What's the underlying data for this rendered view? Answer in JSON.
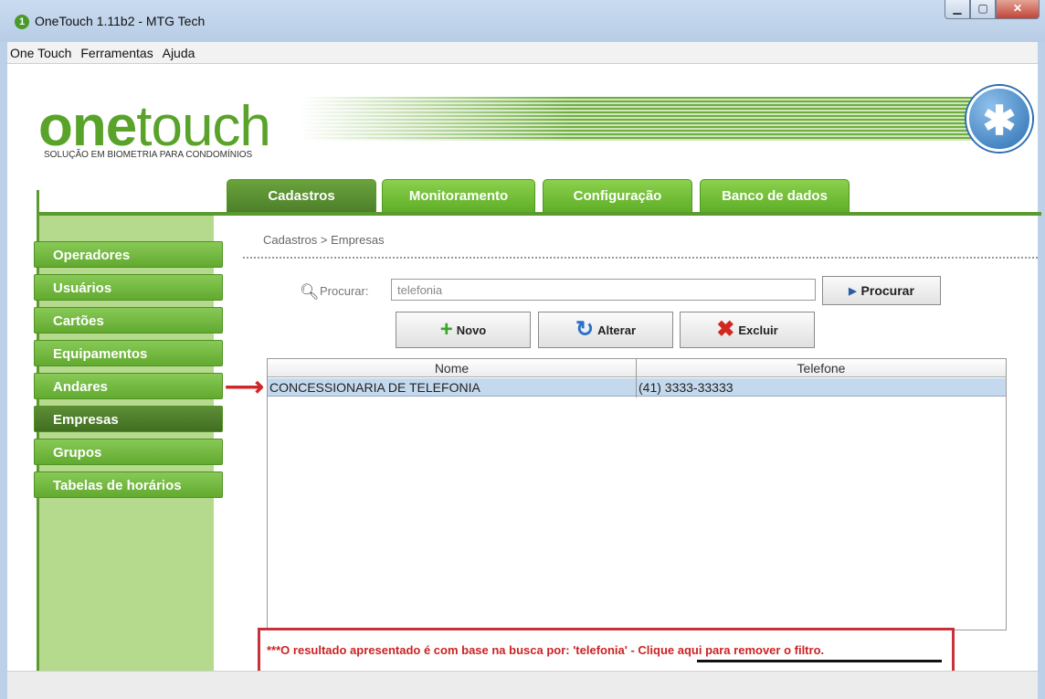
{
  "window": {
    "title": "OneTouch 1.11b2 - MTG Tech",
    "min": "▁",
    "max": "▢",
    "close": "✕"
  },
  "menu": [
    "One Touch",
    "Ferramentas",
    "Ajuda"
  ],
  "banner": {
    "logo_one": "one",
    "logo_touch": "touch",
    "tagline": "SOLUÇÃO EM BIOMETRIA PARA CONDOMÍNIOS",
    "accent": "#5aa32a"
  },
  "tabs": [
    {
      "label": "Cadastros",
      "active": true
    },
    {
      "label": "Monitoramento",
      "active": false
    },
    {
      "label": "Configuração",
      "active": false
    },
    {
      "label": "Banco de dados",
      "active": false
    }
  ],
  "sidebar": [
    {
      "label": "Operadores",
      "active": false
    },
    {
      "label": "Usuários",
      "active": false
    },
    {
      "label": "Cartões",
      "active": false
    },
    {
      "label": "Equipamentos",
      "active": false
    },
    {
      "label": "Andares",
      "active": false
    },
    {
      "label": "Empresas",
      "active": true
    },
    {
      "label": "Grupos",
      "active": false
    },
    {
      "label": "Tabelas de horários",
      "active": false
    }
  ],
  "breadcrumb": "Cadastros > Empresas",
  "search": {
    "label": "Procurar:",
    "value": "telefonia",
    "button": "Procurar"
  },
  "actions": {
    "new": "Novo",
    "edit": "Alterar",
    "delete": "Excluir"
  },
  "table": {
    "columns": [
      "Nome",
      "Telefone"
    ],
    "rows": [
      {
        "nome": "CONCESSIONARIA DE TELEFONIA",
        "telefone": "(41) 3333-33333"
      }
    ]
  },
  "filter_notice": {
    "text": "***O resultado apresentado é com base na busca por: 'telefonia' - ",
    "link": "Clique aqui para remover o filtro."
  }
}
